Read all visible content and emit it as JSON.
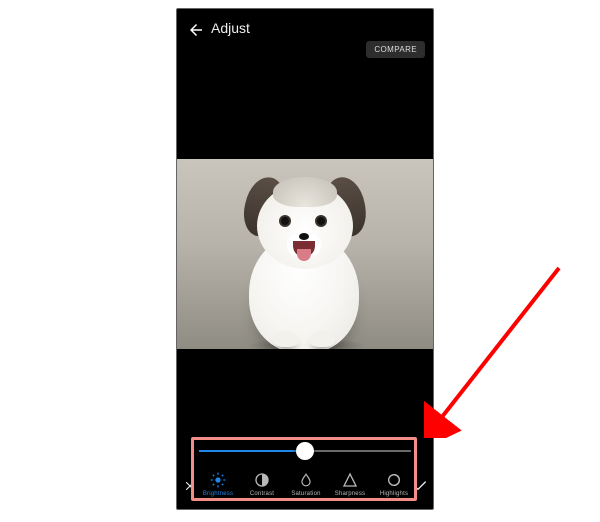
{
  "header": {
    "title": "Adjust",
    "compare_label": "COMPARE"
  },
  "slider": {
    "value_percent": 50
  },
  "options": [
    {
      "label": "Brightness",
      "icon": "brightness-icon",
      "active": true
    },
    {
      "label": "Contrast",
      "icon": "contrast-icon",
      "active": false
    },
    {
      "label": "Saturation",
      "icon": "saturation-icon",
      "active": false
    },
    {
      "label": "Sharpness",
      "icon": "sharpness-icon",
      "active": false
    },
    {
      "label": "Highlights",
      "icon": "highlights-icon",
      "active": false
    }
  ],
  "accent_color": "#1f87e8",
  "highlight_color": "#f38d88"
}
